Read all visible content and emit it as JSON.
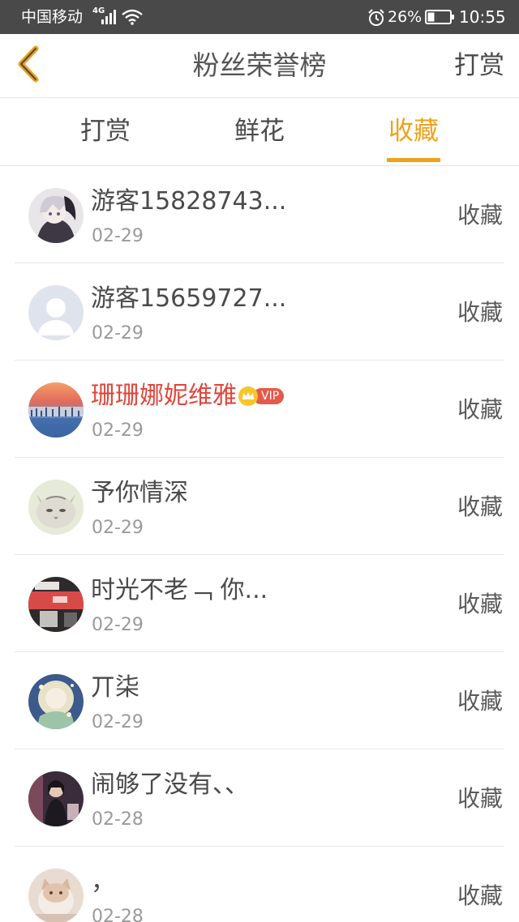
{
  "status_bar": {
    "carrier": "中国移动",
    "network": "4G",
    "battery_percent": "26%",
    "time": "10:55"
  },
  "nav": {
    "title": "粉丝荣誉榜",
    "action_label": "打赏"
  },
  "tabs": [
    {
      "label": "打赏",
      "active": false
    },
    {
      "label": "鲜花",
      "active": false
    },
    {
      "label": "收藏",
      "active": true
    }
  ],
  "colors": {
    "accent": "#f0a11a",
    "vip_name": "#e0463a",
    "status_bar_bg": "#494949"
  },
  "vip_badge_label": "VIP",
  "items": [
    {
      "name": "游客15828743...",
      "date": "02-29",
      "action": "收藏",
      "vip": false,
      "avatar": "anime-boy-avatar"
    },
    {
      "name": "游客15659727...",
      "date": "02-29",
      "action": "收藏",
      "vip": false,
      "avatar": "default-user-avatar"
    },
    {
      "name": "珊珊娜妮维雅",
      "date": "02-29",
      "action": "收藏",
      "vip": true,
      "avatar": "sunset-lake-avatar"
    },
    {
      "name": "予你情深",
      "date": "02-29",
      "action": "收藏",
      "vip": false,
      "avatar": "kitten-avatar"
    },
    {
      "name": "时光不老﹁ 你...",
      "date": "02-29",
      "action": "收藏",
      "vip": false,
      "avatar": "red-photo-avatar"
    },
    {
      "name": "丌柒",
      "date": "02-29",
      "action": "收藏",
      "vip": false,
      "avatar": "anime-girl-avatar"
    },
    {
      "name": "闹够了没有、、",
      "date": "02-28",
      "action": "收藏",
      "vip": false,
      "avatar": "dark-portrait-avatar"
    },
    {
      "name": "，",
      "date": "02-28",
      "action": "收藏",
      "vip": false,
      "avatar": "cat-photo-avatar"
    }
  ]
}
